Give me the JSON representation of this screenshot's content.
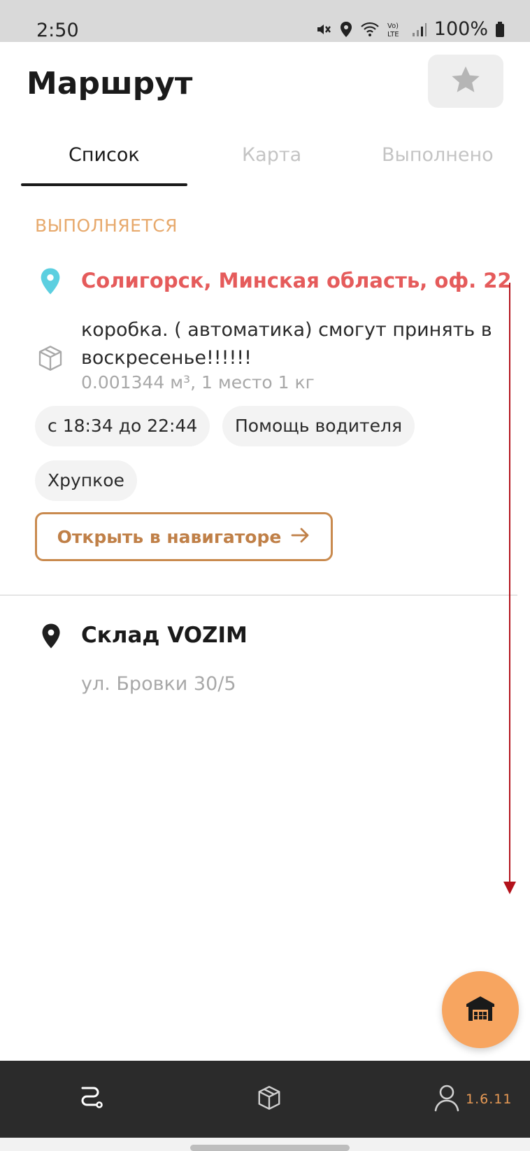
{
  "status_bar": {
    "time": "2:50",
    "battery": "100%",
    "icons": [
      "mute-icon",
      "location-icon",
      "wifi-icon",
      "volte-icon",
      "signal-icon",
      "battery-icon"
    ]
  },
  "header": {
    "title": "Маршрут",
    "favorite_icon": "star-icon"
  },
  "tabs": [
    {
      "label": "Список",
      "active": true
    },
    {
      "label": "Карта",
      "active": false
    },
    {
      "label": "Выполнено",
      "active": false
    }
  ],
  "section_label": "ВЫПОЛНЯЕТСЯ",
  "current_stop": {
    "address": "Солигорск, Минская область, оф. 22",
    "comment_line1": "коробка. ( автоматика) смогут принять в",
    "comment_line2": "воскресенье!!!!!!",
    "cargo": "0.001344 м³, 1 место 1 кг",
    "chips": [
      "с 18:34 до 22:44",
      "Помощь водителя",
      "Хрупкое"
    ],
    "navigator_button": "Открыть в навигаторе"
  },
  "next_stop": {
    "name": "Склад VOZIM",
    "address": "ул. Бровки 30/5"
  },
  "fab_icon": "warehouse-icon",
  "bottom_nav": {
    "items": [
      "route-icon",
      "parcel-icon",
      "profile-icon"
    ],
    "version": "1.6.11"
  },
  "colors": {
    "accent_orange": "#f7a560",
    "address_red": "#e55b5b",
    "pin_cyan": "#5ccfe0",
    "section_label": "#e7a96c",
    "scroll_arrow": "#b3121b",
    "bottom_nav_bg": "#2b2b2b"
  }
}
